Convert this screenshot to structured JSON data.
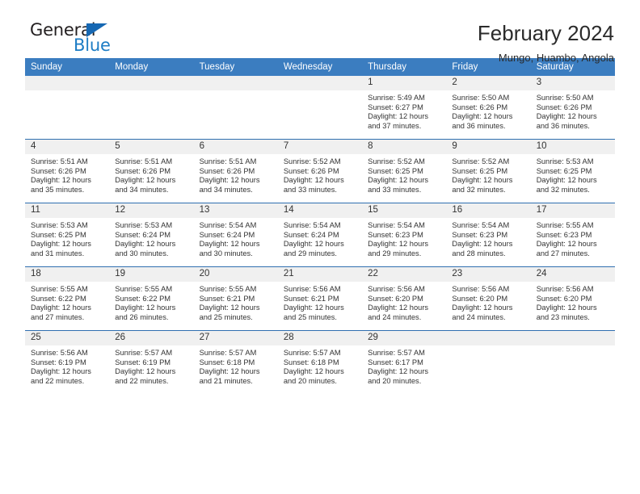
{
  "brand": {
    "name_dark": "General",
    "name_blue": "Blue",
    "accent_color": "#1668b3"
  },
  "header": {
    "month_title": "February 2024",
    "location": "Mungo, Huambo, Angola"
  },
  "calendar": {
    "header_bg": "#3b7dc0",
    "row_divider_color": "#2f6fb0",
    "daynum_bg": "#f0f0f0",
    "weekday_headers": [
      "Sunday",
      "Monday",
      "Tuesday",
      "Wednesday",
      "Thursday",
      "Friday",
      "Saturday"
    ],
    "weeks": [
      [
        {
          "day": "",
          "lines": []
        },
        {
          "day": "",
          "lines": []
        },
        {
          "day": "",
          "lines": []
        },
        {
          "day": "",
          "lines": []
        },
        {
          "day": "1",
          "lines": [
            "Sunrise: 5:49 AM",
            "Sunset: 6:27 PM",
            "Daylight: 12 hours",
            "and 37 minutes."
          ]
        },
        {
          "day": "2",
          "lines": [
            "Sunrise: 5:50 AM",
            "Sunset: 6:26 PM",
            "Daylight: 12 hours",
            "and 36 minutes."
          ]
        },
        {
          "day": "3",
          "lines": [
            "Sunrise: 5:50 AM",
            "Sunset: 6:26 PM",
            "Daylight: 12 hours",
            "and 36 minutes."
          ]
        }
      ],
      [
        {
          "day": "4",
          "lines": [
            "Sunrise: 5:51 AM",
            "Sunset: 6:26 PM",
            "Daylight: 12 hours",
            "and 35 minutes."
          ]
        },
        {
          "day": "5",
          "lines": [
            "Sunrise: 5:51 AM",
            "Sunset: 6:26 PM",
            "Daylight: 12 hours",
            "and 34 minutes."
          ]
        },
        {
          "day": "6",
          "lines": [
            "Sunrise: 5:51 AM",
            "Sunset: 6:26 PM",
            "Daylight: 12 hours",
            "and 34 minutes."
          ]
        },
        {
          "day": "7",
          "lines": [
            "Sunrise: 5:52 AM",
            "Sunset: 6:26 PM",
            "Daylight: 12 hours",
            "and 33 minutes."
          ]
        },
        {
          "day": "8",
          "lines": [
            "Sunrise: 5:52 AM",
            "Sunset: 6:25 PM",
            "Daylight: 12 hours",
            "and 33 minutes."
          ]
        },
        {
          "day": "9",
          "lines": [
            "Sunrise: 5:52 AM",
            "Sunset: 6:25 PM",
            "Daylight: 12 hours",
            "and 32 minutes."
          ]
        },
        {
          "day": "10",
          "lines": [
            "Sunrise: 5:53 AM",
            "Sunset: 6:25 PM",
            "Daylight: 12 hours",
            "and 32 minutes."
          ]
        }
      ],
      [
        {
          "day": "11",
          "lines": [
            "Sunrise: 5:53 AM",
            "Sunset: 6:25 PM",
            "Daylight: 12 hours",
            "and 31 minutes."
          ]
        },
        {
          "day": "12",
          "lines": [
            "Sunrise: 5:53 AM",
            "Sunset: 6:24 PM",
            "Daylight: 12 hours",
            "and 30 minutes."
          ]
        },
        {
          "day": "13",
          "lines": [
            "Sunrise: 5:54 AM",
            "Sunset: 6:24 PM",
            "Daylight: 12 hours",
            "and 30 minutes."
          ]
        },
        {
          "day": "14",
          "lines": [
            "Sunrise: 5:54 AM",
            "Sunset: 6:24 PM",
            "Daylight: 12 hours",
            "and 29 minutes."
          ]
        },
        {
          "day": "15",
          "lines": [
            "Sunrise: 5:54 AM",
            "Sunset: 6:23 PM",
            "Daylight: 12 hours",
            "and 29 minutes."
          ]
        },
        {
          "day": "16",
          "lines": [
            "Sunrise: 5:54 AM",
            "Sunset: 6:23 PM",
            "Daylight: 12 hours",
            "and 28 minutes."
          ]
        },
        {
          "day": "17",
          "lines": [
            "Sunrise: 5:55 AM",
            "Sunset: 6:23 PM",
            "Daylight: 12 hours",
            "and 27 minutes."
          ]
        }
      ],
      [
        {
          "day": "18",
          "lines": [
            "Sunrise: 5:55 AM",
            "Sunset: 6:22 PM",
            "Daylight: 12 hours",
            "and 27 minutes."
          ]
        },
        {
          "day": "19",
          "lines": [
            "Sunrise: 5:55 AM",
            "Sunset: 6:22 PM",
            "Daylight: 12 hours",
            "and 26 minutes."
          ]
        },
        {
          "day": "20",
          "lines": [
            "Sunrise: 5:55 AM",
            "Sunset: 6:21 PM",
            "Daylight: 12 hours",
            "and 25 minutes."
          ]
        },
        {
          "day": "21",
          "lines": [
            "Sunrise: 5:56 AM",
            "Sunset: 6:21 PM",
            "Daylight: 12 hours",
            "and 25 minutes."
          ]
        },
        {
          "day": "22",
          "lines": [
            "Sunrise: 5:56 AM",
            "Sunset: 6:20 PM",
            "Daylight: 12 hours",
            "and 24 minutes."
          ]
        },
        {
          "day": "23",
          "lines": [
            "Sunrise: 5:56 AM",
            "Sunset: 6:20 PM",
            "Daylight: 12 hours",
            "and 24 minutes."
          ]
        },
        {
          "day": "24",
          "lines": [
            "Sunrise: 5:56 AM",
            "Sunset: 6:20 PM",
            "Daylight: 12 hours",
            "and 23 minutes."
          ]
        }
      ],
      [
        {
          "day": "25",
          "lines": [
            "Sunrise: 5:56 AM",
            "Sunset: 6:19 PM",
            "Daylight: 12 hours",
            "and 22 minutes."
          ]
        },
        {
          "day": "26",
          "lines": [
            "Sunrise: 5:57 AM",
            "Sunset: 6:19 PM",
            "Daylight: 12 hours",
            "and 22 minutes."
          ]
        },
        {
          "day": "27",
          "lines": [
            "Sunrise: 5:57 AM",
            "Sunset: 6:18 PM",
            "Daylight: 12 hours",
            "and 21 minutes."
          ]
        },
        {
          "day": "28",
          "lines": [
            "Sunrise: 5:57 AM",
            "Sunset: 6:18 PM",
            "Daylight: 12 hours",
            "and 20 minutes."
          ]
        },
        {
          "day": "29",
          "lines": [
            "Sunrise: 5:57 AM",
            "Sunset: 6:17 PM",
            "Daylight: 12 hours",
            "and 20 minutes."
          ]
        },
        {
          "day": "",
          "lines": []
        },
        {
          "day": "",
          "lines": []
        }
      ]
    ]
  }
}
